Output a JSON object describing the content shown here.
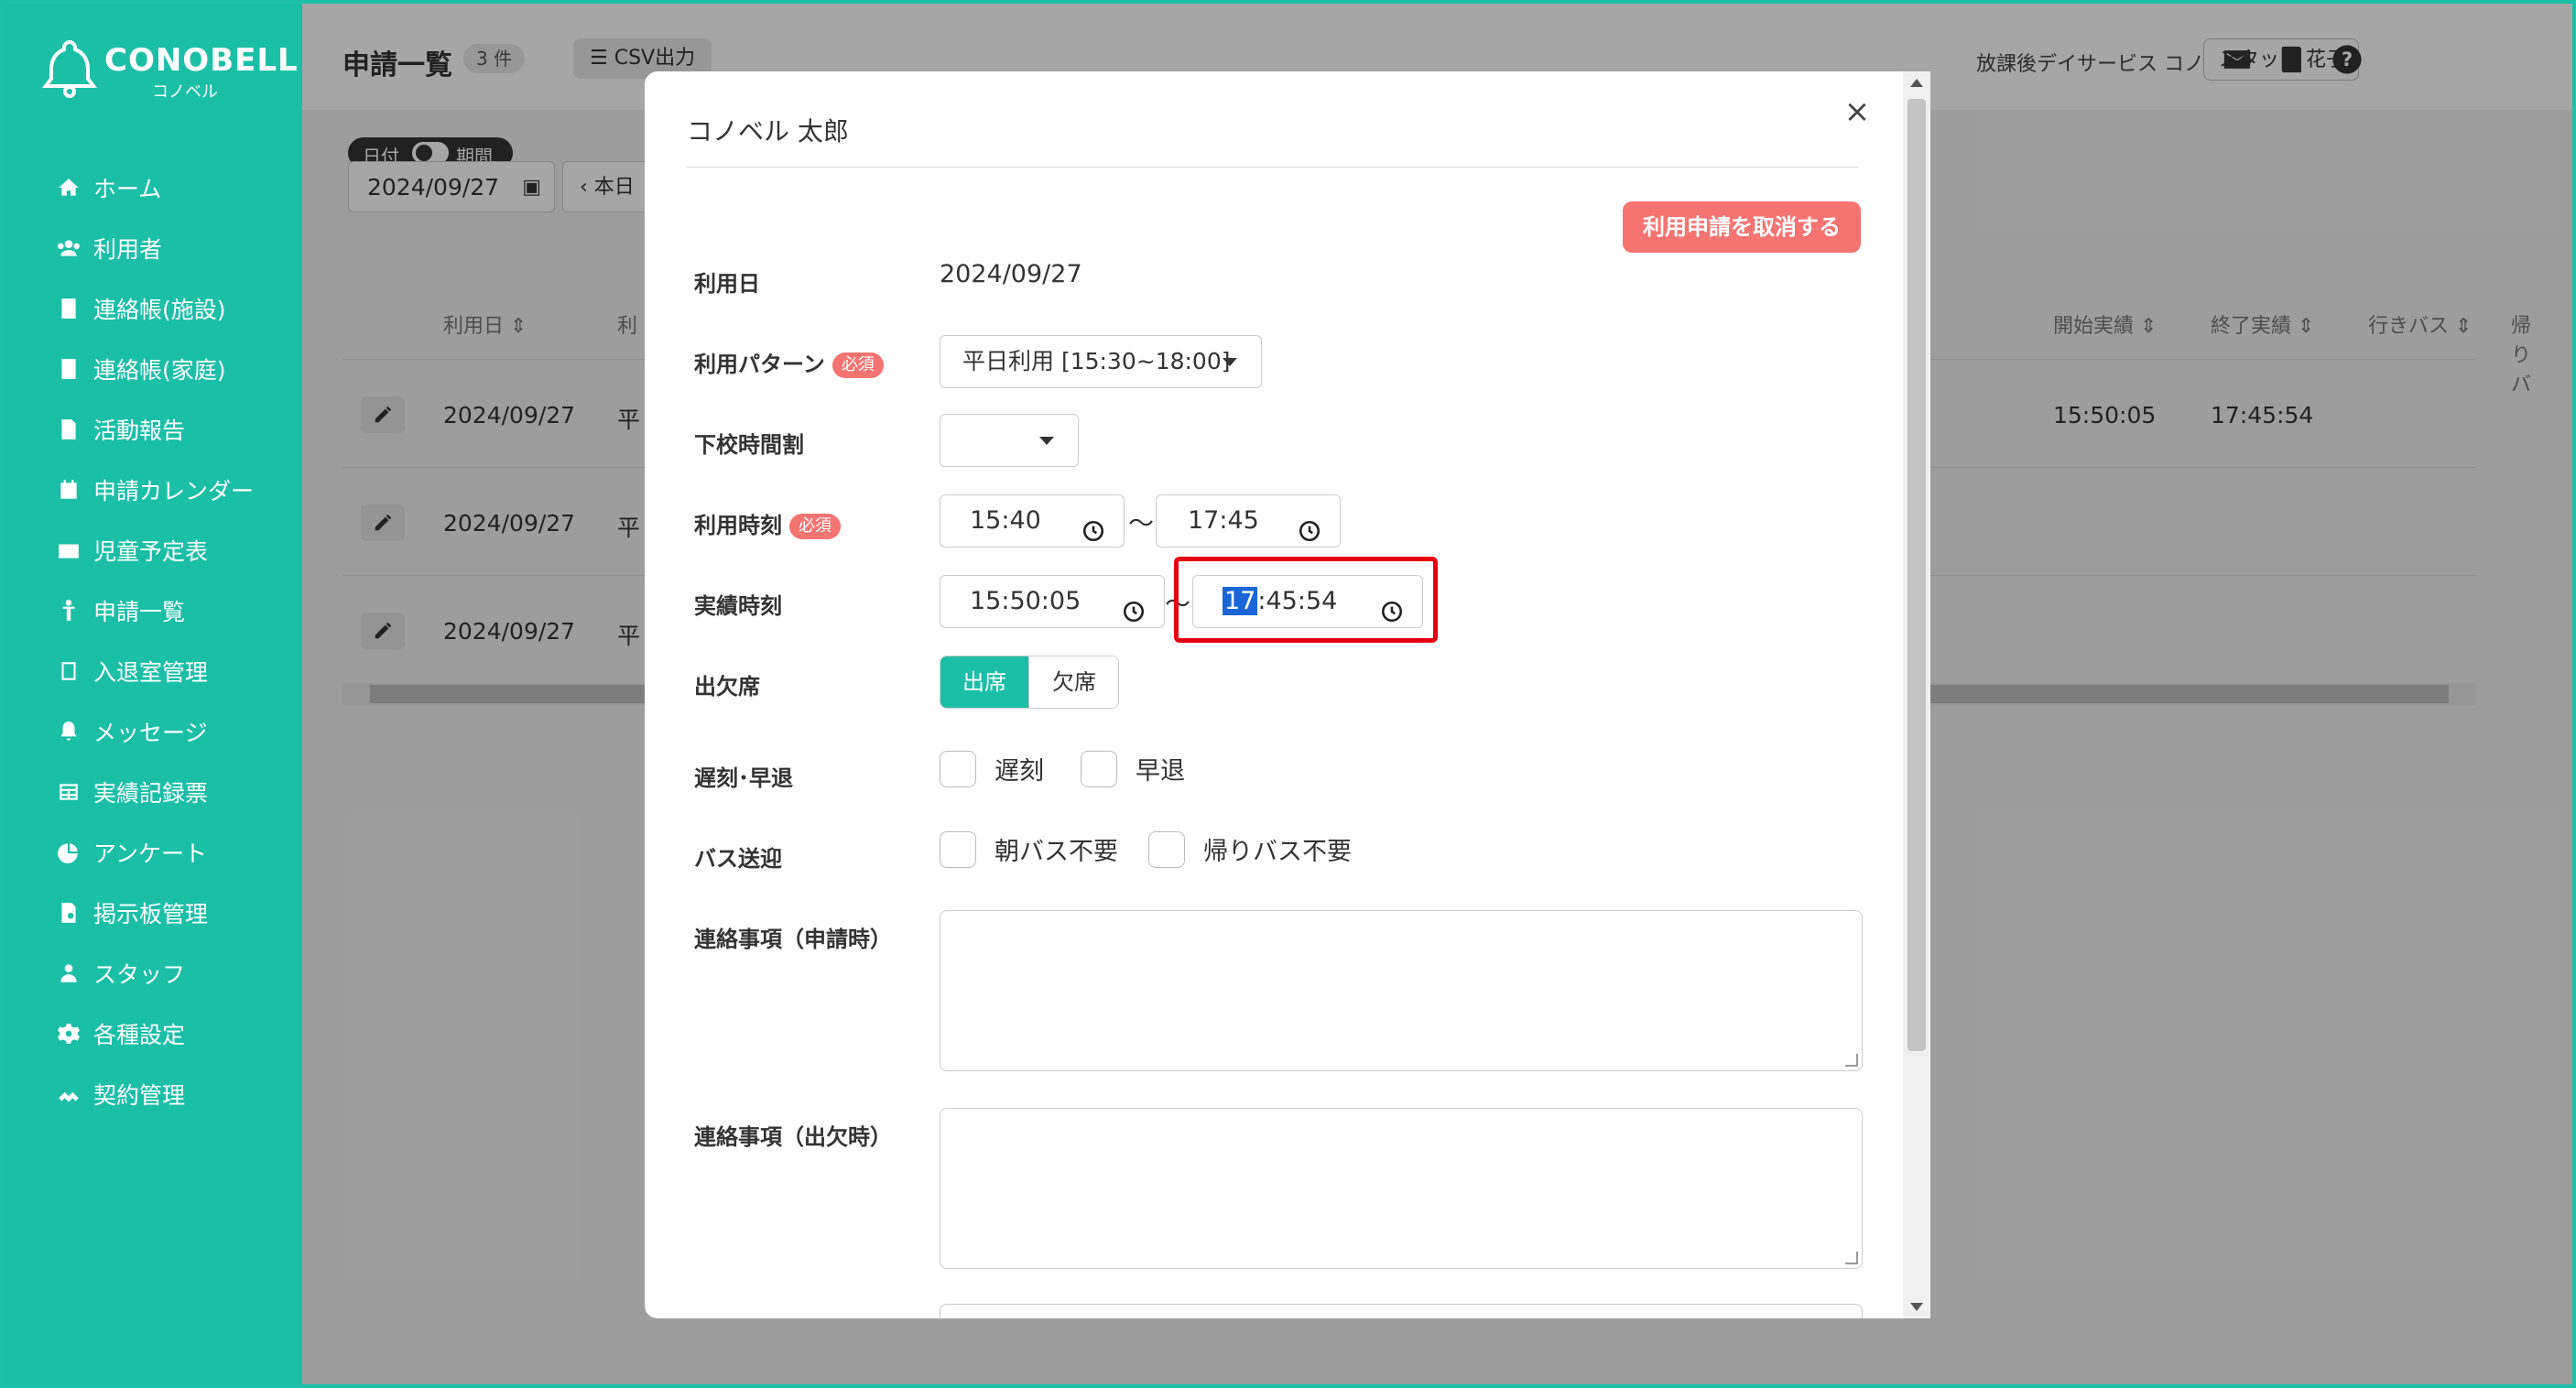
{
  "brand": {
    "name": "CONOBELL",
    "sub": "コノベル"
  },
  "sidebar": {
    "items": [
      {
        "label": "ホーム",
        "icon": "home-icon"
      },
      {
        "label": "利用者",
        "icon": "users-icon"
      },
      {
        "label": "連絡帳(施設)",
        "icon": "notebook-icon"
      },
      {
        "label": "連絡帳(家庭)",
        "icon": "notebook-icon"
      },
      {
        "label": "活動報告",
        "icon": "report-icon"
      },
      {
        "label": "申請カレンダー",
        "icon": "calendar-icon"
      },
      {
        "label": "児童予定表",
        "icon": "schedule-icon"
      },
      {
        "label": "申請一覧",
        "icon": "child-icon"
      },
      {
        "label": "入退室管理",
        "icon": "door-icon"
      },
      {
        "label": "メッセージ",
        "icon": "bell-icon"
      },
      {
        "label": "実績記録票",
        "icon": "table-icon"
      },
      {
        "label": "アンケート",
        "icon": "pie-icon"
      },
      {
        "label": "掲示板管理",
        "icon": "board-icon"
      },
      {
        "label": "スタッフ",
        "icon": "staff-icon"
      },
      {
        "label": "各種設定",
        "icon": "gear-icon"
      },
      {
        "label": "契約管理",
        "icon": "contract-icon"
      }
    ]
  },
  "header": {
    "title": "申請一覧",
    "count": "3 件",
    "csv_label": "CSV出力",
    "facility": "放課後デイサービス コノベル",
    "staff": "スタッフ 花子"
  },
  "filters": {
    "toggle_left": "日付",
    "toggle_right": "期間",
    "date": "2024/09/27",
    "today": "本日"
  },
  "table": {
    "headers": {
      "date": "利用日",
      "pattern_partial": "利",
      "start_actual": "開始実績",
      "end_actual": "終了実績",
      "bus_go": "行きバス",
      "bus_return_partial": "帰りバ"
    },
    "rows": [
      {
        "date": "2024/09/27",
        "pattern_partial": "平",
        "start": "15:50:05",
        "end": "17:45:54"
      },
      {
        "date": "2024/09/27",
        "pattern_partial": "平",
        "start": "",
        "end": ""
      },
      {
        "date": "2024/09/27",
        "pattern_partial": "平",
        "start": "",
        "end": ""
      }
    ]
  },
  "modal": {
    "title": "コノベル 太郎",
    "cancel_label": "利用申請を取消する",
    "required": "必須",
    "fields": {
      "date_label": "利用日",
      "date_value": "2024/09/27",
      "pattern_label": "利用パターン",
      "pattern_value": "平日利用 [15:30~18:00]",
      "school_label": "下校時間割",
      "school_value": "",
      "time_label": "利用時刻",
      "time_start": "15:40",
      "time_end": "17:45",
      "actual_label": "実績時刻",
      "actual_start": "15:50:05",
      "actual_end_selected": "17",
      "actual_end_rest": ":45:54",
      "attendance_label": "出欠席",
      "attend_on": "出席",
      "attend_off": "欠席",
      "late_label": "遅刻･早退",
      "late": "遅刻",
      "early": "早退",
      "bus_label": "バス送迎",
      "bus_morning": "朝バス不要",
      "bus_return": "帰りバス不要",
      "note_apply_label": "連絡事項（申請時）",
      "note_attend_label": "連絡事項（出欠時）",
      "tilde": "〜"
    }
  },
  "colors": {
    "brand": "#1bbfa6",
    "danger": "#f47472",
    "highlight": "#e60012",
    "selection": "#1a66d6"
  }
}
